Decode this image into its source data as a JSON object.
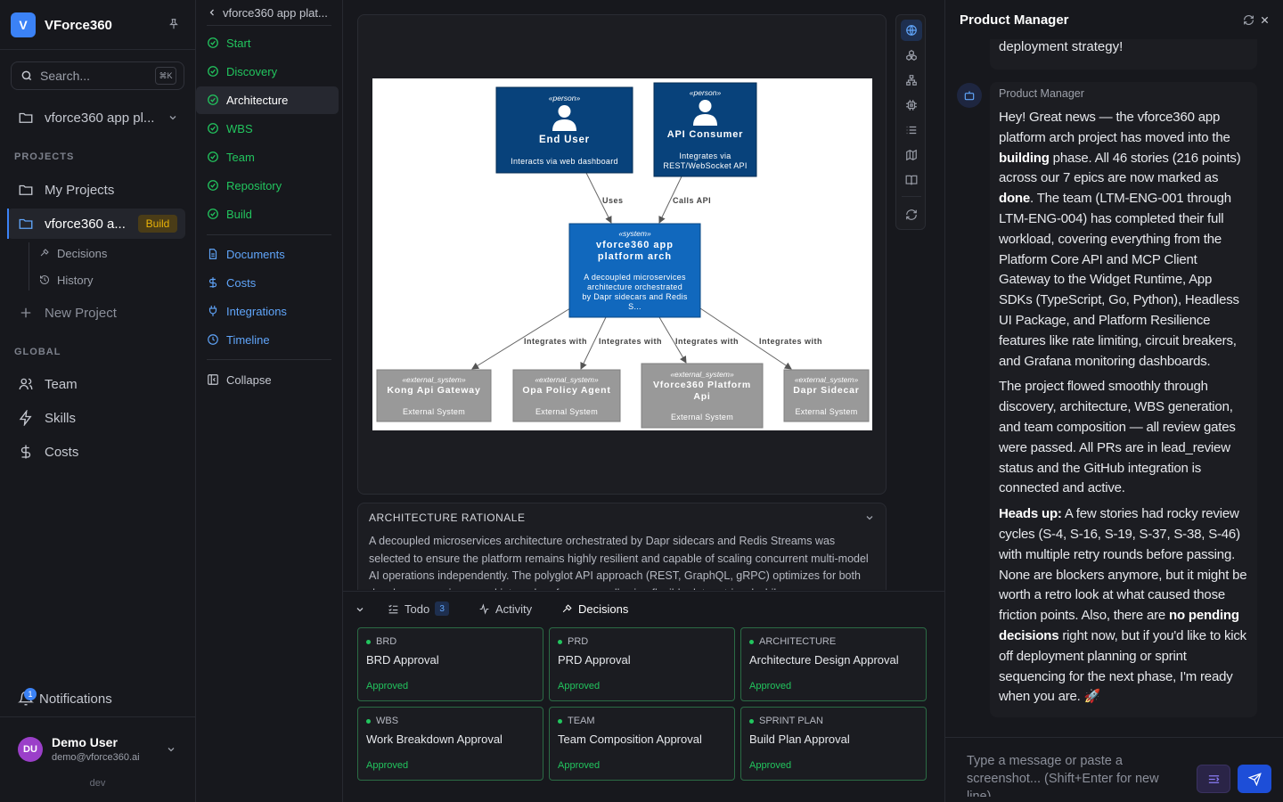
{
  "app": {
    "logo_letter": "V",
    "name": "VForce360"
  },
  "search": {
    "placeholder": "Search...",
    "shortcut": "⌘K"
  },
  "project_selector": {
    "label": "vforce360 app pl..."
  },
  "sidebar": {
    "projects_heading": "PROJECTS",
    "my_projects": "My Projects",
    "active_project": {
      "label": "vforce360 a...",
      "badge": "Build"
    },
    "sub_items": [
      "Decisions",
      "History"
    ],
    "new_project": "New Project",
    "global_heading": "GLOBAL",
    "global_items": [
      "Team",
      "Skills",
      "Costs"
    ],
    "notifications": {
      "label": "Notifications",
      "count": "1"
    },
    "user": {
      "initials": "DU",
      "name": "Demo User",
      "email": "demo@vforce360.ai"
    },
    "env": "dev"
  },
  "phase_nav": {
    "back_label": "vforce360 app plat...",
    "phases": [
      "Start",
      "Discovery",
      "Architecture",
      "WBS",
      "Team",
      "Repository",
      "Build"
    ],
    "active_phase": "Architecture",
    "links": [
      "Documents",
      "Costs",
      "Integrations",
      "Timeline"
    ],
    "collapse": "Collapse"
  },
  "diagram": {
    "persons": [
      {
        "stereo": "«person»",
        "name": "End User",
        "desc": "Interacts via web dashboard"
      },
      {
        "stereo": "«person»",
        "name": "API Consumer",
        "desc1": "Integrates via",
        "desc2": "REST/WebSocket API"
      }
    ],
    "system": {
      "stereo": "«system»",
      "name1": "vforce360 app",
      "name2": "platform arch",
      "desc": [
        "A decoupled microservices",
        "architecture orchestrated",
        "by Dapr sidecars and Redis",
        "S..."
      ]
    },
    "externals": [
      {
        "stereo": "«external_system»",
        "name": "Kong Api Gateway",
        "kind": "External System"
      },
      {
        "stereo": "«external_system»",
        "name": "Opa Policy Agent",
        "kind": "External System"
      },
      {
        "stereo": "«external_system»",
        "name1": "Vforce360 Platform",
        "name2": "Api",
        "kind": "External System"
      },
      {
        "stereo": "«external_system»",
        "name": "Dapr Sidecar",
        "kind": "External System"
      }
    ],
    "edges": {
      "uses": "Uses",
      "calls": "Calls API",
      "integrates": "Integrates with"
    }
  },
  "rationale": {
    "title": "ARCHITECTURE RATIONALE",
    "text": "A decoupled microservices architecture orchestrated by Dapr sidecars and Redis Streams was selected to ensure the platform remains highly resilient and capable of scaling concurrent multi-model AI operations independently. The polyglot API approach (REST, GraphQL, gRPC) optimizes for both developer experience and internal performance, allowing flexible data retrieval while"
  },
  "tabs": {
    "todo": "Todo",
    "todo_count": "3",
    "activity": "Activity",
    "decisions": "Decisions"
  },
  "decisions": [
    {
      "tag": "BRD",
      "title": "BRD Approval",
      "status": "Approved"
    },
    {
      "tag": "PRD",
      "title": "PRD Approval",
      "status": "Approved"
    },
    {
      "tag": "ARCHITECTURE",
      "title": "Architecture Design Approval",
      "status": "Approved"
    },
    {
      "tag": "WBS",
      "title": "Work Breakdown Approval",
      "status": "Approved"
    },
    {
      "tag": "TEAM",
      "title": "Team Composition Approval",
      "status": "Approved"
    },
    {
      "tag": "SPRINT PLAN",
      "title": "Build Plan Approval",
      "status": "Approved"
    }
  ],
  "chat": {
    "title": "Product Manager",
    "prev_message_tail": "deployment strategy!",
    "sender": "Product Manager",
    "p1": {
      "a": "Hey! Great news — the vforce360 app platform arch project has moved into the ",
      "b1": "building",
      "c": " phase. All 46 stories (216 points) across our 7 epics are now marked as ",
      "b2": "done",
      "d": ". The team (LTM-ENG-001 through LTM-ENG-004) has completed their full workload, covering everything from the Platform Core API and MCP Client Gateway to the Widget Runtime, App SDKs (TypeScript, Go, Python), Headless UI Package, and Platform Resilience features like rate limiting, circuit breakers, and Grafana monitoring dashboards."
    },
    "p2": "The project flowed smoothly through discovery, architecture, WBS generation, and team composition — all review gates were passed. All PRs are in lead_review status and the GitHub integration is connected and active.",
    "p3": {
      "b1": "Heads up:",
      "a": " A few stories had rocky review cycles (S-4, S-16, S-19, S-37, S-38, S-46) with multiple retry rounds before passing. None are blockers anymore, but it might be worth a retro look at what caused those friction points. Also, there are ",
      "b2": "no pending decisions",
      "c": " right now, but if you'd like to kick off deployment planning or sprint sequencing for the next phase, I'm ready when you are. 🚀"
    },
    "input_placeholder": "Type a message or paste a screenshot... (Shift+Enter for new line)"
  }
}
